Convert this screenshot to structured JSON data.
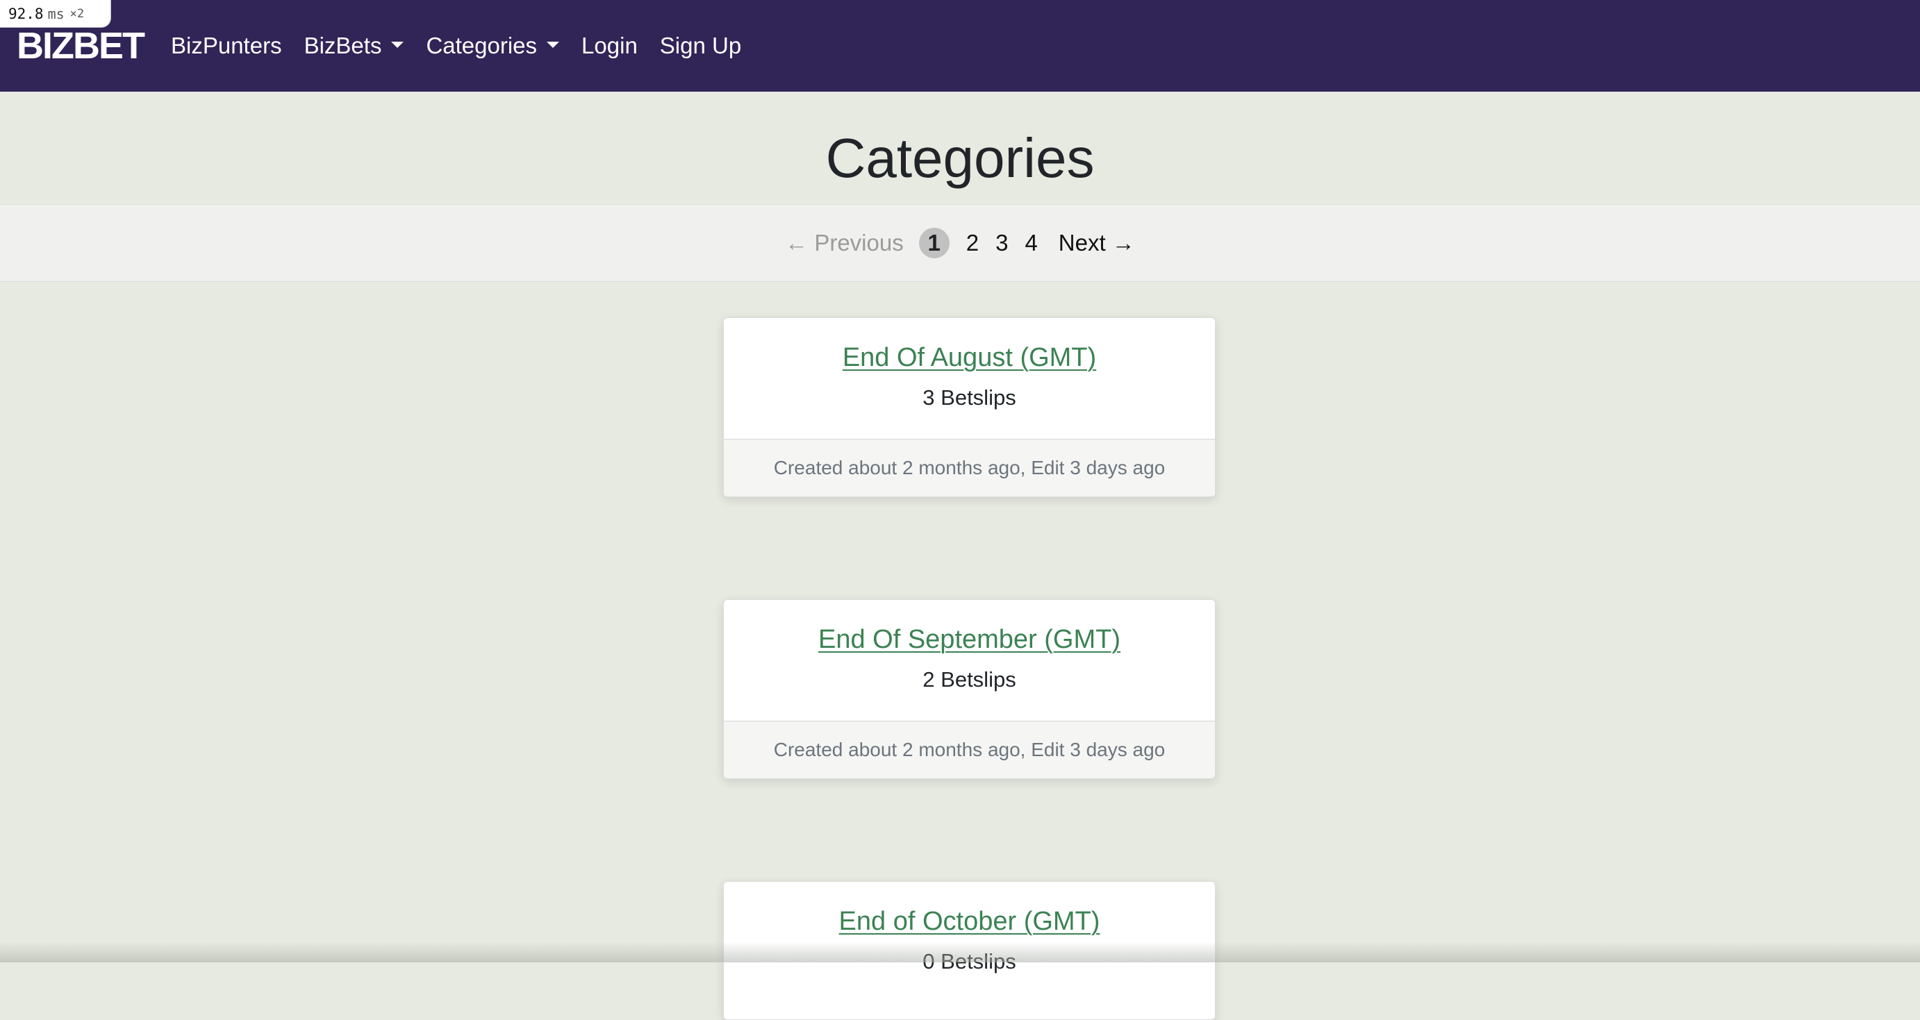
{
  "perf_badge": {
    "value": "92.8",
    "unit": "ms",
    "multiplier": "×2"
  },
  "navbar": {
    "brand": "BIZBET",
    "items": [
      {
        "label": "BizPunters",
        "dropdown": false
      },
      {
        "label": "BizBets",
        "dropdown": true
      },
      {
        "label": "Categories",
        "dropdown": true
      },
      {
        "label": "Login",
        "dropdown": false
      },
      {
        "label": "Sign Up",
        "dropdown": false
      }
    ]
  },
  "page": {
    "title": "Categories"
  },
  "pagination": {
    "previous": "← Previous",
    "current": "1",
    "pages": [
      "2",
      "3",
      "4"
    ],
    "next": "Next →"
  },
  "categories": [
    {
      "title": "End Of August (GMT)",
      "count": "3 Betslips",
      "footer": "Created about 2 months ago, Edit 3 days ago"
    },
    {
      "title": "End Of September (GMT)",
      "count": "2 Betslips",
      "footer": "Created about 2 months ago, Edit 3 days ago"
    },
    {
      "title": "End of October (GMT)",
      "count": "0 Betslips",
      "footer": ""
    }
  ],
  "colors": {
    "navbar_bg": "#312457",
    "page_bg": "#e7eae1",
    "link_green": "#3b8253",
    "pagination_bg": "#f0f0ef"
  }
}
